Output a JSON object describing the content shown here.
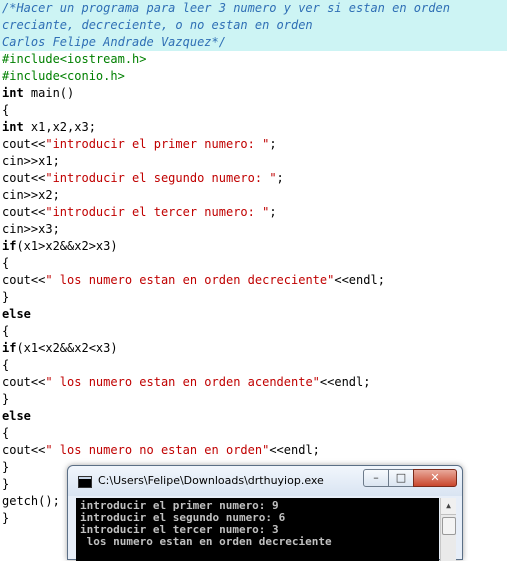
{
  "code": {
    "comment_lines": [
      "/*Hacer un programa para leer 3 numero y ver si estan en orden",
      "creciante, decreciente, o no estan en orden",
      "Carlos Felipe Andrade Vazquez*/"
    ],
    "include1": "#include<iostream.h>",
    "include2": "#include<conio.h>",
    "main_kw": "int",
    "main_rest": " main()",
    "brace_open": "{",
    "brace_close": "}",
    "decl_kw": "int",
    "decl_rest": " x1,x2,x3;",
    "cout": "cout<<",
    "endl": "<<endl;",
    "semi": ";",
    "prompt1": "\"introducir el primer numero: \"",
    "cin1": "cin>>x1;",
    "prompt2": "\"introducir el segundo numero: \"",
    "cin2": "cin>>x2;",
    "prompt3": "\"introducir el tercer numero: \"",
    "cin3": "cin>>x3;",
    "if_kw": "if",
    "cond1": "(x1>x2&&x2>x3)",
    "msg_dec": "\" los numero estan en orden decreciente\"",
    "else_kw": "else",
    "cond2": "(x1<x2&&x2<x3)",
    "msg_asc": "\" los numero estan en orden acendente\"",
    "msg_none": "\" los numero no estan en orden\"",
    "getch": "getch();"
  },
  "console": {
    "title": "C:\\Users\\Felipe\\Downloads\\drthuyiop.exe",
    "lines": [
      "introducir el primer numero: 9",
      "introducir el segundo numero: 6",
      "introducir el tercer numero: 3",
      " los numero estan en orden decreciente"
    ],
    "btn_min": "–",
    "btn_max": "□",
    "btn_close": "✕",
    "scroll_up": "▲"
  },
  "colors": {
    "comment": "#2f6fb5",
    "preprocessor": "#008000",
    "string": "#c00000",
    "highlight": "#cdf4f4"
  }
}
